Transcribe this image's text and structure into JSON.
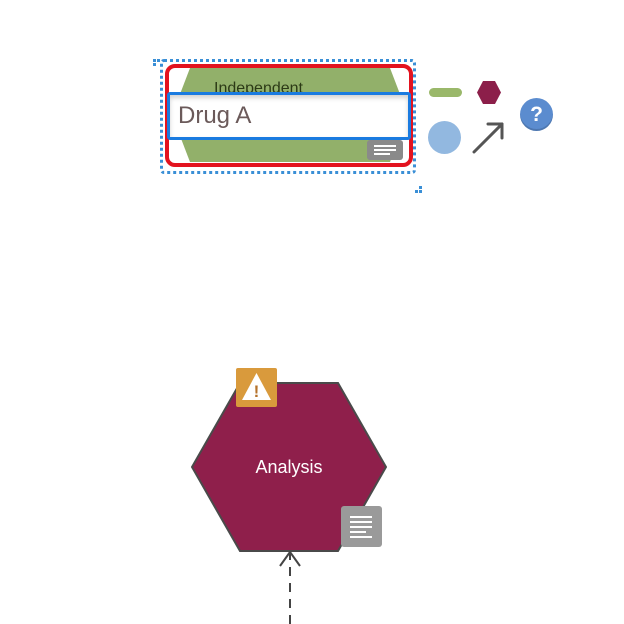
{
  "selected_node": {
    "label_partial": "Independent",
    "edit_value": "Drug A",
    "shape": "hexagon",
    "fill_color": "#92b06a",
    "selection_color": "#3a8fd6",
    "error_outline_color": "#e3131f"
  },
  "quick_palette": {
    "items": [
      {
        "icon": "edge-line-icon",
        "color": "#9ab86a"
      },
      {
        "icon": "hexagon-node-icon",
        "color": "#8c1f4a"
      },
      {
        "icon": "circle-node-icon",
        "color": "#92b8e0"
      },
      {
        "icon": "connect-arrow-icon",
        "color": "#555555"
      },
      {
        "icon": "help-icon",
        "color": "#5b8ccf"
      }
    ],
    "help_glyph": "?"
  },
  "analysis_node": {
    "label": "Analysis",
    "shape": "hexagon",
    "fill_color": "#8f1f4b",
    "warning_icon": "warning-icon",
    "warning_glyph": "!",
    "notes_icon": "notes-icon"
  },
  "edge": {
    "style": "dashed",
    "direction": "into-analysis"
  }
}
